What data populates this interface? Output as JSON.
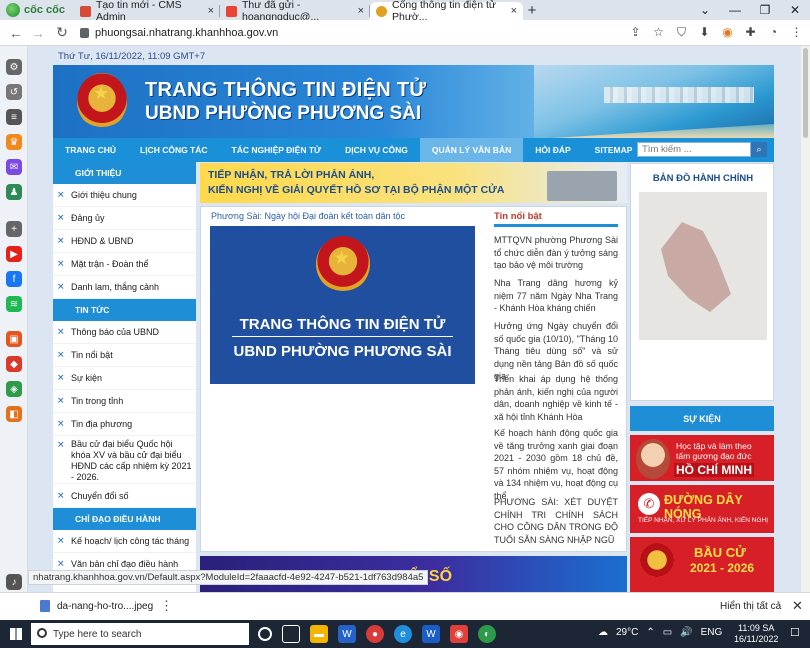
{
  "browser": {
    "brand": "cốc cốc",
    "tabs": [
      {
        "title": "Tạo tin mới - CMS Admin",
        "close": "×"
      },
      {
        "title": "Thư đã gửi - hoangngduc@...",
        "close": "×"
      },
      {
        "title": "Cổng thông tin điện tử Phườ...",
        "close": "×"
      }
    ],
    "new_tab": "+",
    "address": "phuongsai.nhatrang.khanhhoa.gov.vn",
    "status_url": "nhatrang.khanhhoa.gov.vn/Default.aspx?ModuleId=2faaacfd-4e92-4247-b521-1df763d984a5"
  },
  "site": {
    "date": "Thứ Tư, 16/11/2022, 11:09 GMT+7",
    "banner_title_1": "TRANG THÔNG TIN ĐIỆN TỬ",
    "banner_title_2": "UBND PHƯỜNG PHƯƠNG SÀI",
    "menu": [
      "TRANG CHỦ",
      "LỊCH CÔNG TÁC",
      "TÁC NGHIỆP ĐIỆN TỬ",
      "DỊCH VỤ CÔNG",
      "QUẢN LÝ VĂN BẢN",
      "HỎI ĐÁP",
      "SITEMAP"
    ],
    "search_placeholder": "Tìm kiếm ...",
    "left_sections": [
      {
        "title": "GIỚI THIỆU",
        "items": [
          "Giới thiệu chung",
          "Đảng ủy",
          "HĐND & UBND",
          "Mặt trận - Đoàn thể",
          "Danh lam, thắng cảnh"
        ]
      },
      {
        "title": "TIN TỨC",
        "items": [
          "Thông báo của UBND",
          "Tin nổi bật",
          "Sự kiện",
          "Tin trong tỉnh",
          "Tin địa phương",
          "Bầu cử đại biểu Quốc hội khóa XV và bầu cử đại biểu HĐND các cấp nhiệm kỳ 2021 - 2026.",
          "Chuyển đổi số"
        ]
      },
      {
        "title": "CHỈ ĐẠO ĐIỀU HÀNH",
        "items": [
          "Kế hoạch/ lịch công tác tháng",
          "Văn bản chỉ đạo điều hành"
        ]
      }
    ],
    "hero_line_1": "TIẾP NHẬN, TRẢ LỜI PHẢN ÁNH,",
    "hero_line_2": "KIẾN NGHỊ VỀ GIẢI QUYẾT HỒ SƠ TẠI BỘ PHẬN MỘT CỬA",
    "featured_title": "Phương Sài: Ngày hội Đại đoàn kết toàn dân tộc",
    "featured_img_line_1": "TRANG THÔNG TIN ĐIỆN TỬ",
    "featured_img_line_2": "UBND PHƯỜNG PHƯƠNG SÀI",
    "hot_title": "Tin nổi bật",
    "hot_items": [
      "MTTQVN phường Phương Sài tổ chức diễn đàn ý tưởng sáng tạo bảo vệ môi trường",
      "Nha Trang dâng hương kỷ niệm 77 năm Ngày Nha Trang - Khánh Hòa kháng chiến",
      "Hưởng ứng Ngày chuyển đổi số quốc gia (10/10), \"Tháng 10 Tháng tiêu dùng số\" và sử dụng nền tảng Bản đồ số quốc gia",
      "Triển khai áp dụng hệ thống phản ánh, kiến nghị của người dân, doanh nghiệp về kinh tế - xã hội tỉnh Khánh Hòa",
      "Kế hoạch hành động quốc gia về tăng trưởng xanh giai đoạn 2021 - 2030 gồm 18 chủ đề, 57 nhóm nhiệm vụ, hoạt động và 134 nhiệm vụ, hoạt động cụ thể",
      "PHƯƠNG SÀI: XÉT DUYỆT CHÍNH TRI CHÍNH SÁCH CHO CÔNG DÂN TRONG ĐỘ TUỔI SẴN SÀNG NHẬP NGŨ"
    ],
    "bottom_strip": "ĐỔI SỐ",
    "map_title": "BẢN ĐỒ HÀNH CHÍNH",
    "events_title": "SỰ KIỆN",
    "ad1": {
      "l1": "Học tập và làm theo",
      "l2": "tấm gương đạo đức",
      "l3": "HỒ CHÍ MINH"
    },
    "ad2": {
      "l1": "ĐƯỜNG DÂY NÓNG",
      "l2": "TIẾP NHẬN, XỬ LÝ PHẢN ÁNH, KIẾN NGHỊ"
    },
    "ad3": {
      "l1": "BẦU CỬ",
      "l2": "2021 - 2026"
    }
  },
  "download": {
    "file": "da-nang-ho-tro....jpeg",
    "show_all": "Hiển thị tất cả"
  },
  "taskbar": {
    "search": "Type here to search",
    "temp": "29°C",
    "lang": "ENG",
    "time": "11:09 SA",
    "date": "16/11/2022"
  }
}
